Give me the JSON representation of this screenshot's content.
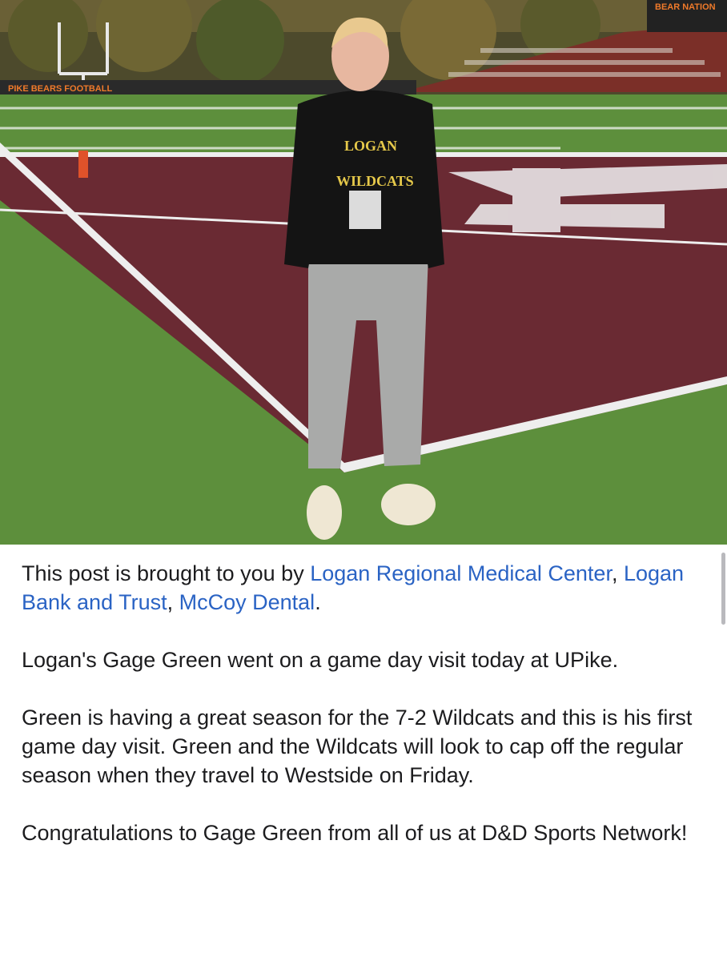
{
  "photo": {
    "alt_subject": "football-recruit-photo",
    "stadium_banner_left": "PIKE BEARS FOOTBALL",
    "stadium_banner_right": "BEAR NATION",
    "hoodie_line1": "LOGAN",
    "hoodie_line2": "WILDCATS",
    "colors": {
      "turf": "#5d8f3c",
      "endzone": "#6a2a33",
      "hoodie": "#141414",
      "pants": "#a9aaa9",
      "hoodie_text": "#e6c94a"
    }
  },
  "post": {
    "sponsor_prefix": "This post is brought to you by ",
    "sponsors": [
      {
        "label": "Logan Regional Medical Center",
        "sep": ", "
      },
      {
        "label": "Logan Bank and Trust",
        "sep": ", "
      },
      {
        "label": "McCoy Dental",
        "sep": "."
      }
    ],
    "paragraphs": [
      "Logan's Gage Green went on a game day visit today at UPike.",
      "Green is having a great season for the 7-2 Wildcats and this is his first game day visit. Green and the Wildcats will look to cap off the regular season when they travel to Westside on Friday.",
      "Congratulations to Gage Green from all of us at D&D Sports Network!"
    ],
    "link_color": "#2a63c4"
  }
}
